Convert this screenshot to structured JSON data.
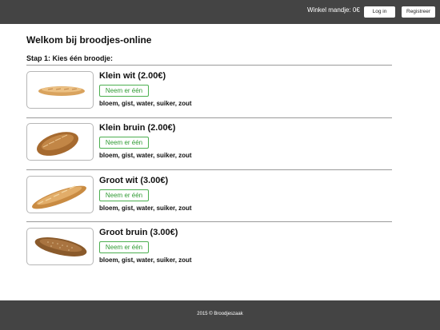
{
  "header": {
    "cart": "Winkel mandje: 0€",
    "login": "Log in",
    "register": "Registreer"
  },
  "main": {
    "title": "Welkom bij broodjes-online",
    "step": "Stap 1: Kies één broodje:",
    "products": [
      {
        "name": "Klein wit (2.00€)",
        "button": "Neem er één",
        "ingredients": "bloem, gist, water, suiker, zout",
        "icon": "small-white-bread-icon"
      },
      {
        "name": "Klein bruin (2.00€)",
        "button": "Neem er één",
        "ingredients": "bloem, gist, water, suiker, zout",
        "icon": "small-brown-bread-icon"
      },
      {
        "name": "Groot wit (3.00€)",
        "button": "Neem er één",
        "ingredients": "bloem, gist, water, suiker, zout",
        "icon": "large-white-bread-icon"
      },
      {
        "name": "Groot bruin (3.00€)",
        "button": "Neem er één",
        "ingredients": "bloem, gist, water, suiker, zout",
        "icon": "large-brown-bread-icon"
      }
    ]
  },
  "footer": {
    "text": "2015 © Broodjeszaak"
  },
  "colors": {
    "bar": "#444444",
    "accent_green": "#2e9a32"
  }
}
